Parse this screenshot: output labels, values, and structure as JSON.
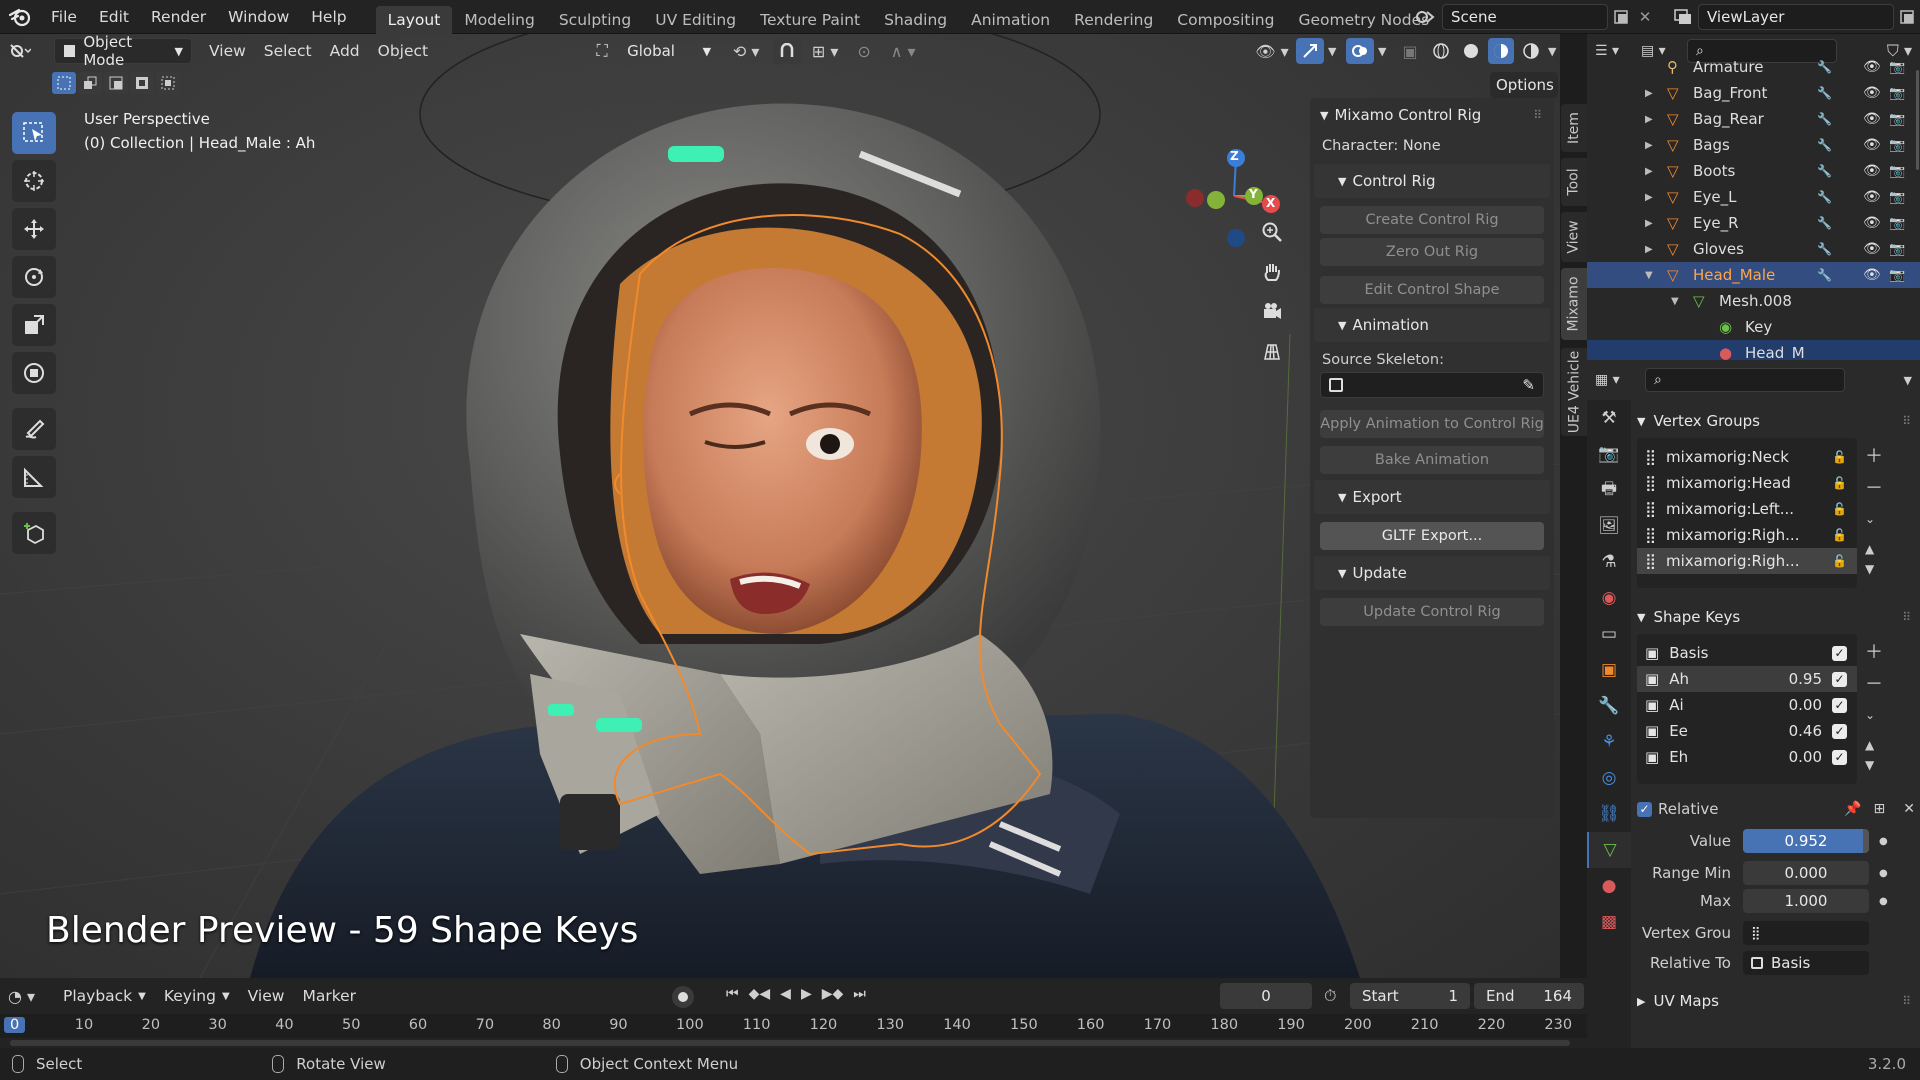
{
  "topbar": {
    "menus": [
      "File",
      "Edit",
      "Render",
      "Window",
      "Help"
    ],
    "workspaces": [
      "Layout",
      "Modeling",
      "Sculpting",
      "UV Editing",
      "Texture Paint",
      "Shading",
      "Animation",
      "Rendering",
      "Compositing",
      "Geometry Nodes",
      "Scripting"
    ],
    "scene": "Scene",
    "view_layer": "ViewLayer"
  },
  "viewport_header": {
    "mode": "Object Mode",
    "menus": [
      "View",
      "Select",
      "Add",
      "Object"
    ],
    "transform_orientation": "Global",
    "options": "Options"
  },
  "viewport": {
    "perspective": "User Perspective",
    "collection_info": "(0) Collection | Head_Male : Ah",
    "overlay_caption": "Blender Preview - 59 Shape Keys",
    "gizmo_axes": {
      "z": "Z",
      "y": "Y",
      "x": "X"
    },
    "colors": {
      "accent": "#4772b3",
      "selection": "#f08a2c",
      "axis_x": "#e64a4a",
      "axis_y": "#84b33a",
      "axis_z": "#3a7ed8"
    }
  },
  "npanel": {
    "title": "Mixamo Control Rig",
    "character": "Character: None",
    "control_rig_title": "Control Rig",
    "create_control_rig": "Create Control Rig",
    "zero_out_rig": "Zero Out Rig",
    "edit_control_shape": "Edit Control Shape",
    "animation_title": "Animation",
    "source_skeleton_label": "Source Skeleton:",
    "apply_animation": "Apply Animation to Control Rig",
    "bake_animation": "Bake Animation",
    "export_title": "Export",
    "gltf_export": "GLTF Export...",
    "update_title": "Update",
    "update_control_rig": "Update Control Rig",
    "tabs": [
      "Item",
      "Tool",
      "View",
      "Mixamo",
      "UE4 Vehicle"
    ]
  },
  "outliner": {
    "items": [
      {
        "name": "Armature",
        "level": 1,
        "type": "armature"
      },
      {
        "name": "Bag_Front",
        "level": 1,
        "type": "object"
      },
      {
        "name": "Bag_Rear",
        "level": 1,
        "type": "object"
      },
      {
        "name": "Bags",
        "level": 1,
        "type": "object"
      },
      {
        "name": "Boots",
        "level": 1,
        "type": "object"
      },
      {
        "name": "Eye_L",
        "level": 1,
        "type": "object"
      },
      {
        "name": "Eye_R",
        "level": 1,
        "type": "object"
      },
      {
        "name": "Gloves",
        "level": 1,
        "type": "object"
      },
      {
        "name": "Head_Male",
        "level": 1,
        "type": "object",
        "selected": true
      },
      {
        "name": "Mesh.008",
        "level": 2,
        "type": "mesh"
      },
      {
        "name": "Key",
        "level": 3,
        "type": "key"
      },
      {
        "name": "Head_M",
        "level": 3,
        "type": "material"
      }
    ]
  },
  "properties": {
    "vertex_groups_title": "Vertex Groups",
    "vertex_groups": [
      "mixamorig:Neck",
      "mixamorig:Head",
      "mixamorig:Left...",
      "mixamorig:Righ...",
      "mixamorig:Righ..."
    ],
    "shape_keys_title": "Shape Keys",
    "shape_keys": [
      {
        "name": "Basis",
        "value": ""
      },
      {
        "name": "Ah",
        "value": "0.95"
      },
      {
        "name": "Ai",
        "value": "0.00"
      },
      {
        "name": "Ee",
        "value": "0.46"
      },
      {
        "name": "Eh",
        "value": "0.00"
      }
    ],
    "relative_label": "Relative",
    "value_label": "Value",
    "value": "0.952",
    "range_min_label": "Range Min",
    "range_min": "0.000",
    "max_label": "Max",
    "max": "1.000",
    "vertex_group_label": "Vertex Grou",
    "relative_to_label": "Relative To",
    "relative_to": "Basis",
    "uv_maps_title": "UV Maps"
  },
  "timeline": {
    "menus": [
      "Playback",
      "Keying",
      "View",
      "Marker"
    ],
    "current_frame": "0",
    "start_label": "Start",
    "start": "1",
    "end_label": "End",
    "end": "164",
    "ruler": [
      "0",
      "10",
      "20",
      "30",
      "40",
      "50",
      "60",
      "70",
      "80",
      "90",
      "100",
      "110",
      "120",
      "130",
      "140",
      "150",
      "160",
      "170",
      "180",
      "190",
      "200",
      "210",
      "220",
      "230"
    ]
  },
  "status": {
    "select": "Select",
    "rotate_view": "Rotate View",
    "context_menu": "Object Context Menu",
    "version": "3.2.0"
  }
}
